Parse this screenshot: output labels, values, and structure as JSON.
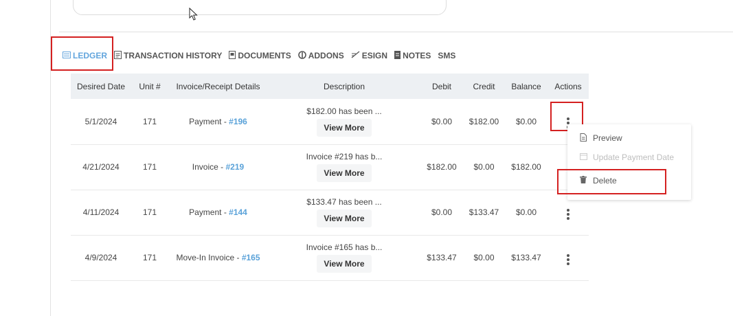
{
  "tabs": [
    {
      "label": "LEDGER",
      "icon": "ledger-icon",
      "active": true
    },
    {
      "label": "TRANSACTION HISTORY",
      "icon": "transaction-history-icon"
    },
    {
      "label": "DOCUMENTS",
      "icon": "documents-icon"
    },
    {
      "label": "ADDONS",
      "icon": "addons-icon"
    },
    {
      "label": "ESIGN",
      "icon": "esign-icon"
    },
    {
      "label": "NOTES",
      "icon": "notes-icon"
    },
    {
      "label": "SMS",
      "icon": ""
    }
  ],
  "table": {
    "headers": [
      "Desired Date",
      "Unit #",
      "Invoice/Receipt Details",
      "Description",
      "Debit",
      "Credit",
      "Balance",
      "Actions"
    ],
    "view_more_label": "View More",
    "rows": [
      {
        "date": "5/1/2024",
        "unit": "171",
        "detail_prefix": "Payment - ",
        "detail_ref": "#196",
        "description": "$182.00 has been ...",
        "debit": "$0.00",
        "credit": "$182.00",
        "balance": "$0.00"
      },
      {
        "date": "4/21/2024",
        "unit": "171",
        "detail_prefix": "Invoice - ",
        "detail_ref": "#219",
        "description": "Invoice #219 has b...",
        "debit": "$182.00",
        "credit": "$0.00",
        "balance": "$182.00"
      },
      {
        "date": "4/11/2024",
        "unit": "171",
        "detail_prefix": "Payment - ",
        "detail_ref": "#144",
        "description": "$133.47 has been ...",
        "debit": "$0.00",
        "credit": "$133.47",
        "balance": "$0.00"
      },
      {
        "date": "4/9/2024",
        "unit": "171",
        "detail_prefix": "Move-In Invoice - ",
        "detail_ref": "#165",
        "description": "Invoice #165 has b...",
        "debit": "$133.47",
        "credit": "$0.00",
        "balance": "$133.47"
      }
    ]
  },
  "action_menu": {
    "items": [
      {
        "label": "Preview",
        "icon": "preview-icon",
        "disabled": false
      },
      {
        "label": "Update Payment Date",
        "icon": "calendar-icon",
        "disabled": true
      },
      {
        "label": "Delete",
        "icon": "trash-icon",
        "disabled": false
      }
    ]
  },
  "colors": {
    "accent": "#62a5dd",
    "link": "#5aa2d9",
    "highlight": "#d42020",
    "header_bg": "#edf0f3"
  }
}
